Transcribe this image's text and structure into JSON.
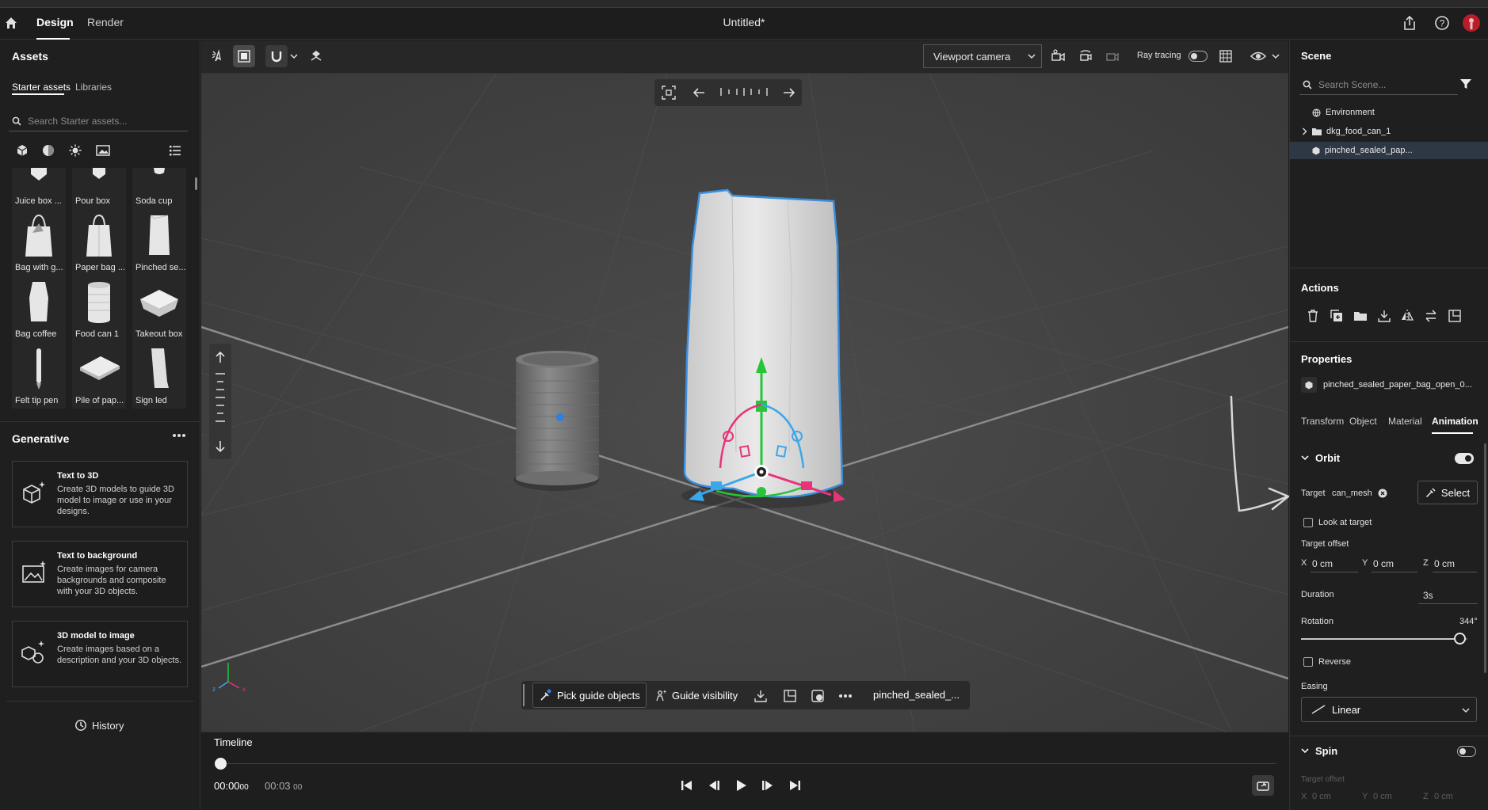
{
  "app": {
    "title": "Untitled*",
    "tabs": [
      "Design",
      "Render"
    ],
    "active_tab": "Design"
  },
  "assets": {
    "title": "Assets",
    "tabs": [
      "Starter assets",
      "Libraries"
    ],
    "search_placeholder": "Search Starter assets...",
    "items": [
      "Juice box ...",
      "Pour box",
      "Soda cup",
      "Bag with g...",
      "Paper bag ...",
      "Pinched se...",
      "Bag coffee",
      "Food can 1",
      "Takeout box",
      "Felt tip pen",
      "Pile of pap...",
      "Sign led"
    ]
  },
  "generative": {
    "title": "Generative",
    "cards": [
      {
        "title": "Text to 3D",
        "desc": "Create 3D models to guide 3D model to image or use in your designs."
      },
      {
        "title": "Text to background",
        "desc": "Create images for camera backgrounds and composite with your 3D objects."
      },
      {
        "title": "3D model to image",
        "desc": "Create images based on a description and your 3D objects."
      }
    ],
    "history": "History"
  },
  "viewport": {
    "camera": "Viewport camera",
    "ray_tracing": "Ray tracing",
    "pick_guide": "Pick guide objects",
    "guide_visibility": "Guide visibility",
    "selection": "pinched_sealed_..."
  },
  "timeline": {
    "title": "Timeline",
    "current": "00:00",
    "current_frames": "00",
    "total": "00:03",
    "total_frames": "00",
    "progress": 0
  },
  "scene": {
    "title": "Scene",
    "search_placeholder": "Search Scene...",
    "items": [
      "Environment",
      "dkg_food_can_1",
      "pinched_sealed_pap..."
    ]
  },
  "actions": {
    "title": "Actions"
  },
  "properties": {
    "title": "Properties",
    "object_name": "pinched_sealed_paper_bag_open_0...",
    "tabs": [
      "Transform",
      "Object",
      "Material",
      "Animation"
    ],
    "active_tab": "Animation",
    "orbit": {
      "label": "Orbit",
      "enabled": true,
      "target_label": "Target",
      "target": "can_mesh",
      "select": "Select",
      "look_at_target": "Look at target",
      "target_offset": "Target offset",
      "x_label": "X",
      "x": "0 cm",
      "y_label": "Y",
      "y": "0 cm",
      "z_label": "Z",
      "z": "0 cm",
      "duration_label": "Duration",
      "duration": "3s",
      "rotation_label": "Rotation",
      "rotation": "344°",
      "rotation_fraction": 0.956,
      "reverse": "Reverse",
      "easing_label": "Easing",
      "easing": "Linear"
    },
    "spin": {
      "label": "Spin",
      "enabled": false,
      "target_offset": "Target offset",
      "x_label": "X",
      "x": "0 cm",
      "y_label": "Y",
      "y": "0 cm",
      "z_label": "Z",
      "z": "0 cm"
    }
  },
  "colors": {
    "selection_outline": "#3b8fe0",
    "gizmo_green": "#27c43a",
    "gizmo_pink": "#e8337a",
    "gizmo_blue": "#3ba7ea"
  }
}
